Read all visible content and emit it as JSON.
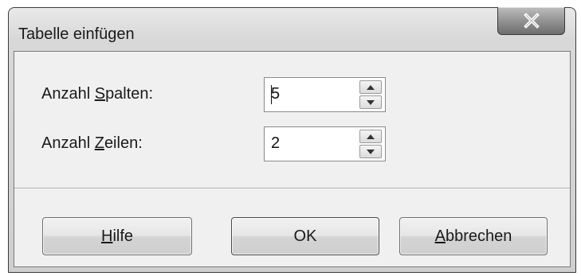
{
  "dialog": {
    "title": "Tabelle einfügen",
    "close_icon": "close-icon"
  },
  "fields": {
    "columns": {
      "label_pre": "Anzahl ",
      "label_key": "S",
      "label_post": "palten:",
      "value": "5"
    },
    "rows": {
      "label_pre": "Anzahl ",
      "label_key": "Z",
      "label_post": "eilen:",
      "value": "2"
    }
  },
  "buttons": {
    "help_key": "H",
    "help_rest": "ilfe",
    "ok": "OK",
    "cancel_key": "A",
    "cancel_rest": "bbrechen"
  },
  "icons": {
    "spin_up": "chevron-up-icon",
    "spin_down": "chevron-down-icon"
  }
}
